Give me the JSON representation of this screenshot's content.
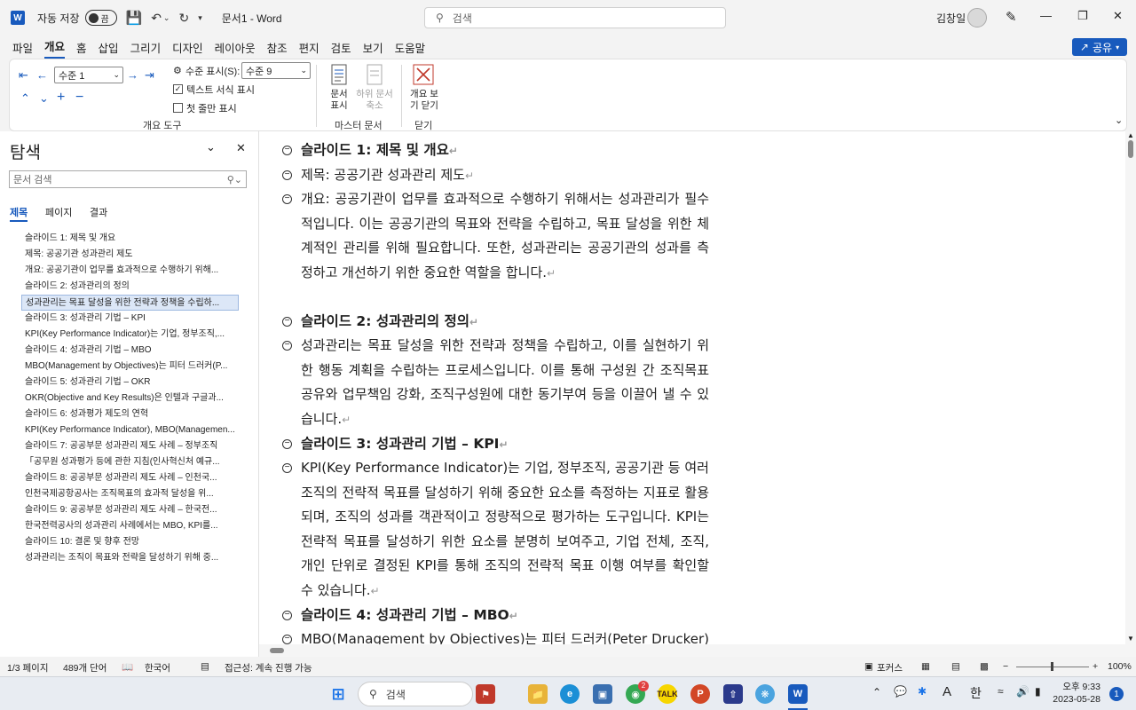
{
  "titlebar": {
    "autosave_label": "자동 저장",
    "autosave_state": "끔",
    "doc_title": "문서1  -  Word",
    "search_placeholder": "검색",
    "user_name": "김창일"
  },
  "menu": [
    "파일",
    "개요",
    "홈",
    "삽입",
    "그리기",
    "디자인",
    "레이아웃",
    "참조",
    "편지",
    "검토",
    "보기",
    "도움말"
  ],
  "share_label": "공유",
  "ribbon": {
    "level_value": "수준 1",
    "show_level_label": "수준 표시(S):",
    "show_level_value": "수준 9",
    "show_text_format": "텍스트 서식 표시",
    "first_line_only": "첫 줄만 표시",
    "group_outline_tools": "개요 도구",
    "show_document": "문서\n표시",
    "collapse_subdocs": "하위 문서\n축소",
    "group_master": "마스터 문서",
    "close_outline": "개요 보\n기 닫기",
    "group_close": "닫기"
  },
  "nav": {
    "title": "탐색",
    "search_placeholder": "문서 검색",
    "tabs": [
      "제목",
      "페이지",
      "결과"
    ],
    "items": [
      "슬라이드 1: 제목 및 개요",
      "제목: 공공기관 성과관리 제도",
      "개요: 공공기관이 업무를 효과적으로 수행하기 위해...",
      "슬라이드 2: 성과관리의 정의",
      "성과관리는 목표 달성을 위한 전략과 정책을 수립하...",
      "슬라이드 3: 성과관리 기법 – KPI",
      "KPI(Key Performance Indicator)는 기업, 정부조직,...",
      "슬라이드 4: 성과관리 기법 – MBO",
      "MBO(Management by Objectives)는 피터 드러커(P...",
      "슬라이드 5: 성과관리 기법 – OKR",
      "OKR(Objective and Key Results)은 인텔과 구글과...",
      "슬라이드 6: 성과평가 제도의 연혁",
      "KPI(Key Performance Indicator), MBO(Managemen...",
      "슬라이드 7: 공공부문 성과관리 제도 사례 – 정부조직",
      "「공무원 성과평가 등에 관한 지침(인사혁신처 예규...",
      "슬라이드 8: 공공부문 성과관리 제도 사례 – 인천국...",
      "인천국제공항공사는 조직목표의 효과적 달성을 위...",
      "슬라이드 9: 공공부문 성과관리 제도 사례 – 한국전...",
      "한국전력공사의 성과관리 사례에서는 MBO, KPI를...",
      "슬라이드 10: 결론 및 향후 전망",
      "성과관리는 조직이 목표와 전략을 달성하기 위해 중..."
    ],
    "selected_index": 4
  },
  "document": {
    "paragraphs": [
      {
        "text": "슬라이드 1: 제목 및 개요",
        "heading": true
      },
      {
        "text": "제목: 공공기관 성과관리 제도",
        "heading": false
      },
      {
        "text": "개요: 공공기관이 업무를 효과적으로 수행하기 위해서는 성과관리가 필수적입니다. 이는 공공기관의 목표와 전략을 수립하고, 목표 달성을 위한 체계적인 관리를 위해 필요합니다. 또한, 성과관리는 공공기관의 성과를 측정하고 개선하기 위한 중요한 역할을 합니다.",
        "heading": false
      },
      {
        "text": "슬라이드 2: 성과관리의 정의",
        "heading": true
      },
      {
        "text": "성과관리는 목표 달성을 위한 전략과 정책을 수립하고, 이를 실현하기 위한 행동 계획을 수립하는 프로세스입니다. 이를 통해 구성원 간 조직목표 공유와 업무책임 강화, 조직구성원에 대한 동기부여 등을 이끌어 낼 수 있습니다.",
        "heading": false
      },
      {
        "text": "슬라이드 3: 성과관리 기법 – KPI",
        "heading": true
      },
      {
        "text": "KPI(Key Performance Indicator)는 기업, 정부조직, 공공기관 등 여러 조직의 전략적 목표를 달성하기 위해 중요한 요소를 측정하는 지표로 활용되며, 조직의 성과를 객관적이고 정량적으로 평가하는 도구입니다. KPI는 전략적 목표를 달성하기 위한 요소를 분명히 보여주고, 기업 전체, 조직, 개인 단위로 결정된 KPI를 통해 조직의 전략적 목표 이행 여부를 확인할 수 있습니다.",
        "heading": false
      },
      {
        "text": "슬라이드 4: 성과관리 기법 – MBO",
        "heading": true
      },
      {
        "text": "MBO(Management by Objectives)는 피터 드러커(Peter Drucker)가",
        "heading": false
      }
    ]
  },
  "status": {
    "page": "1/3 페이지",
    "words": "489개 단어",
    "language": "한국어",
    "accessibility": "접근성: 계속 진행 가능",
    "focus": "포커스",
    "zoom": "100%"
  },
  "taskbar": {
    "search_label": "검색",
    "time": "오후 9:33",
    "date": "2023-05-28",
    "ime": "한",
    "ime_mode": "A",
    "notification_count": "1",
    "chrome_badge": "2"
  }
}
